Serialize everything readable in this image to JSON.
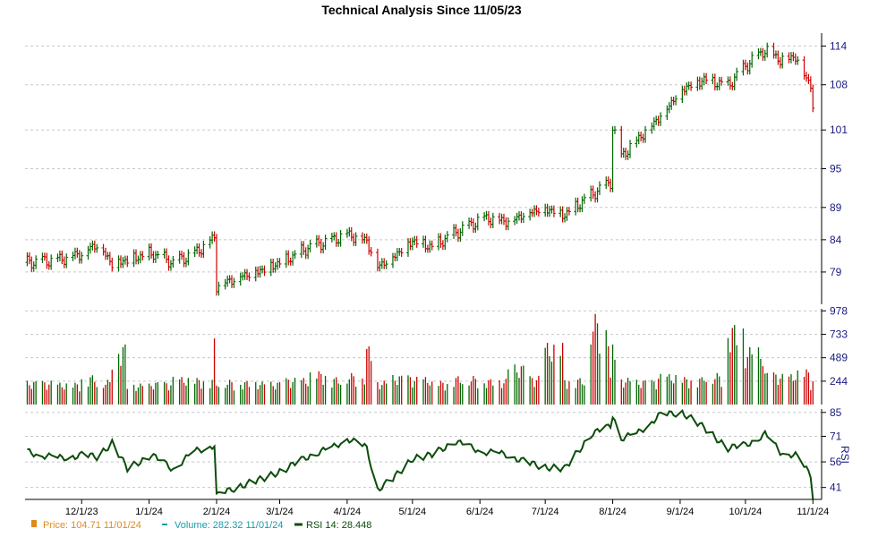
{
  "chart_data": [
    {
      "type": "ohlc",
      "title": "Technical Analysis Since 11/05/23",
      "y_ticks": [
        79,
        84,
        89,
        95,
        101,
        108,
        114
      ],
      "ylim": [
        74,
        116
      ],
      "x_tick_labels": [
        "12/1/23",
        "1/1/24",
        "2/1/24",
        "3/1/24",
        "4/1/24",
        "5/1/24",
        "6/1/24",
        "7/1/24",
        "8/1/24",
        "9/1/24",
        "10/1/24",
        "11/1/24"
      ],
      "x_tick_dates": [
        "2023-12-01",
        "2024-01-01",
        "2024-02-01",
        "2024-03-01",
        "2024-04-01",
        "2024-05-01",
        "2024-06-01",
        "2024-07-01",
        "2024-08-01",
        "2024-09-01",
        "2024-10-01",
        "2024-11-01"
      ],
      "x_range": [
        "2023-11-05",
        "2024-11-05"
      ],
      "up_color": "#006600",
      "down_color": "#cc0000",
      "series": [
        {
          "dates": [
            "2023-11-06",
            "2023-11-20",
            "2023-12-01",
            "2023-12-08",
            "2023-12-15",
            "2023-12-22",
            "2024-01-02",
            "2024-01-12",
            "2024-01-22",
            "2024-01-31",
            "2024-02-01",
            "2024-02-12",
            "2024-02-22",
            "2024-03-04",
            "2024-03-15",
            "2024-03-25",
            "2024-04-01",
            "2024-04-10",
            "2024-04-15",
            "2024-04-22",
            "2024-05-01",
            "2024-05-10",
            "2024-05-20",
            "2024-06-03",
            "2024-06-14",
            "2024-06-24",
            "2024-07-01",
            "2024-07-10",
            "2024-07-22",
            "2024-07-31",
            "2024-08-01",
            "2024-08-05",
            "2024-08-12",
            "2024-08-22",
            "2024-09-02",
            "2024-09-12",
            "2024-09-23",
            "2024-10-01",
            "2024-10-10",
            "2024-10-17",
            "2024-10-24",
            "2024-10-31",
            "2024-11-01"
          ],
          "close": [
            80.5,
            81.0,
            82.0,
            83.5,
            80.5,
            81.0,
            82.0,
            80.5,
            82.0,
            84.5,
            77.0,
            78.5,
            79.5,
            81.0,
            83.0,
            84.0,
            85.0,
            84.0,
            80.0,
            81.5,
            84.0,
            83.0,
            85.0,
            87.5,
            87.0,
            88.5,
            89.0,
            88.0,
            91.0,
            93.0,
            101.5,
            97.0,
            99.5,
            103.0,
            107.5,
            109.0,
            108.0,
            111.0,
            113.5,
            112.0,
            112.5,
            108.0,
            104.71
          ]
        }
      ]
    },
    {
      "type": "bar",
      "y_ticks": [
        244,
        489,
        733,
        978
      ],
      "ylim": [
        0,
        1000
      ],
      "values": [
        250,
        230,
        310,
        260,
        640,
        220,
        240,
        290,
        280,
        700,
        260,
        250,
        240,
        280,
        350,
        290,
        330,
        620,
        250,
        310,
        290,
        250,
        300,
        270,
        420,
        300,
        650,
        280,
        950,
        300,
        640,
        280,
        260,
        320,
        290,
        330,
        850,
        600,
        340,
        320,
        370,
        260,
        282.32
      ]
    },
    {
      "type": "line",
      "y_ticks": [
        41,
        56,
        71,
        85
      ],
      "ylim": [
        34,
        87
      ],
      "ylabel": "RSI",
      "values": [
        62,
        58,
        60,
        59,
        67,
        52,
        60,
        52,
        62,
        66,
        36,
        42,
        46,
        52,
        60,
        64,
        70,
        64,
        40,
        46,
        58,
        60,
        68,
        62,
        60,
        55,
        53,
        52,
        72,
        77,
        84,
        70,
        72,
        83,
        85,
        76,
        64,
        66,
        72,
        62,
        60,
        48,
        36
      ]
    }
  ],
  "legend": {
    "price": "Price: 104.71  11/01/24",
    "volume": "Volume: 282.32  11/01/24",
    "rsi": "RSI 14: 28.448"
  },
  "colors": {
    "price": "#e08a1e",
    "volume": "#1c9aa8",
    "rsi": "#0b4d0b",
    "axis_labels": "#1a1a80"
  }
}
